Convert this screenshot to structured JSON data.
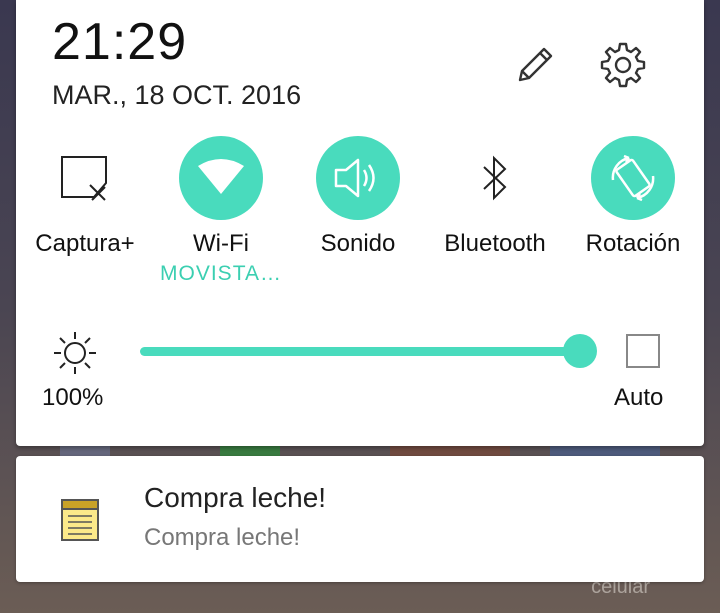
{
  "header": {
    "time": "21:29",
    "date": "MAR., 18 OCT. 2016"
  },
  "quick_settings": [
    {
      "label": "Captura+",
      "icon": "capture-plus-icon",
      "active": false
    },
    {
      "label": "Wi-Fi",
      "sublabel": "MOVISTA…",
      "icon": "wifi-icon",
      "active": true
    },
    {
      "label": "Sonido",
      "icon": "speaker-icon",
      "active": true
    },
    {
      "label": "Bluetooth",
      "icon": "bluetooth-icon",
      "active": false
    },
    {
      "label": "Rotación",
      "icon": "rotation-icon",
      "active": true
    }
  ],
  "brightness": {
    "value_label": "100%",
    "level": 1.0,
    "auto_label": "Auto",
    "auto_checked": false
  },
  "notification": {
    "title": "Compra leche!",
    "text": "Compra leche!",
    "icon": "notepad-icon"
  },
  "wallpaper": {
    "visible_label": "celular"
  },
  "colors": {
    "accent": "#49dbbd"
  }
}
